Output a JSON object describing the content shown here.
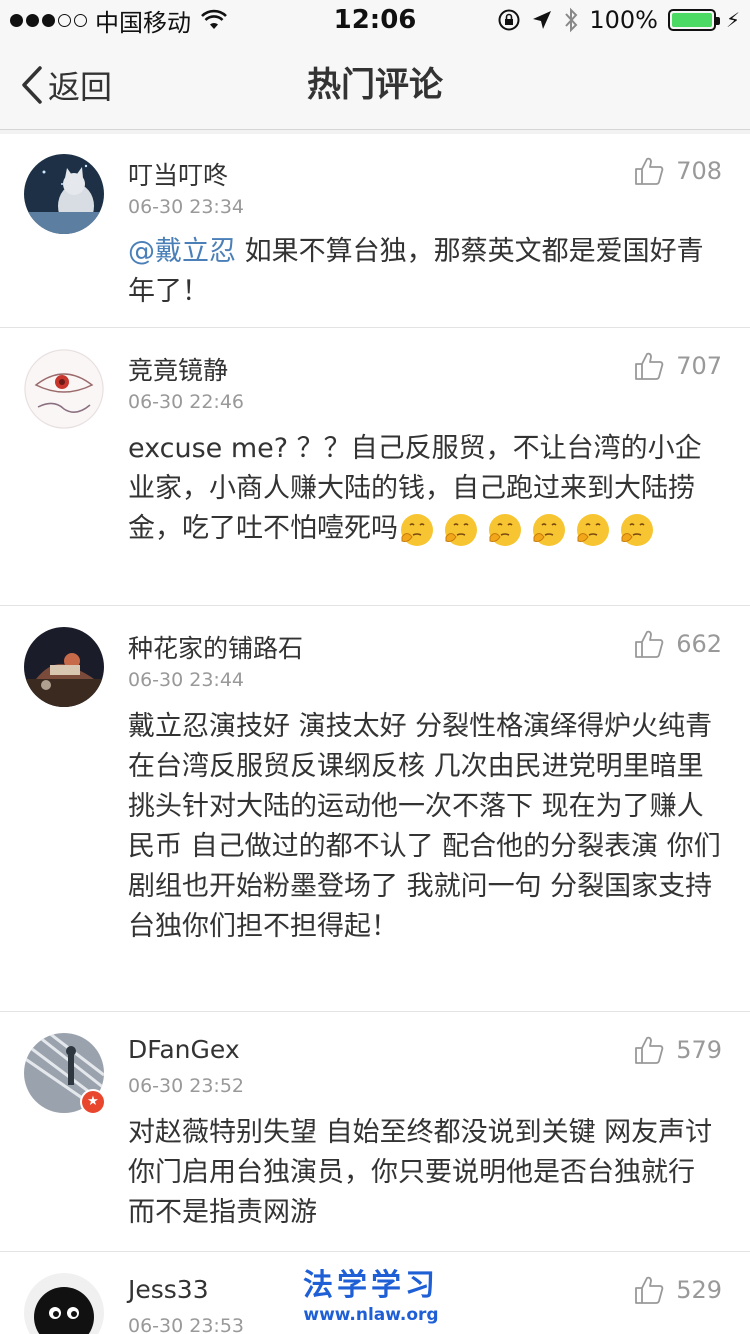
{
  "status_bar": {
    "carrier": "中国移动",
    "time": "12:06",
    "battery": "100%",
    "signal_icons": [
      "lock-rotation-icon",
      "location-arrow-icon",
      "bluetooth-icon"
    ]
  },
  "nav": {
    "back_label": "返回",
    "title": "热门评论"
  },
  "comments": [
    {
      "user": "叮当叮咚",
      "time": "06-30 23:34",
      "likes": "708",
      "mention": "@戴立忍",
      "text": " 如果不算台独，那蔡英文都是爱国好青年了！"
    },
    {
      "user": "竞竟镜静",
      "time": "06-30 22:46",
      "likes": "707",
      "text": "excuse me? ？？自己反服贸，不让台湾的小企业家，小商人赚大陆的钱，自己跑过来到大陆捞金，吃了吐不怕噎死吗",
      "emoji_count": 6
    },
    {
      "user": "种花家的铺路石",
      "time": "06-30 23:44",
      "likes": "662",
      "text": "戴立忍演技好 演技太好 分裂性格演绎得炉火纯青 在台湾反服贸反课纲反核 几次由民进党明里暗里挑头针对大陆的运动他一次不落下 现在为了赚人民币 自己做过的都不认了 配合他的分裂表演 你们剧组也开始粉墨登场了 我就问一句 分裂国家支持台独你们担不担得起！"
    },
    {
      "user": "DFanGex",
      "time": "06-30 23:52",
      "likes": "579",
      "text": "对赵薇特别失望 自始至终都没说到关键 网友声讨你门启用台独演员，你只要说明他是否台独就行 而不是指责网游"
    },
    {
      "user": "Jess33",
      "time": "06-30 23:53",
      "likes": "529"
    }
  ],
  "watermark": {
    "title": "法学学习",
    "url": "www.nlaw.org"
  },
  "colors": {
    "mention": "#4a7fb8",
    "battery": "#4cd964",
    "watermark": "#1f5fd6"
  }
}
